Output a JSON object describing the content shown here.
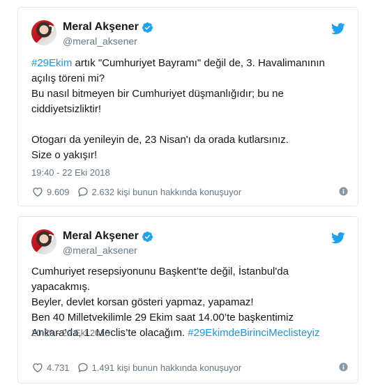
{
  "tweets": [
    {
      "author": "Meral Akşener",
      "handle": "@meral_aksener",
      "lines": [
        {
          "hashtag": "#29Ekim",
          "text": " artık \"Cumhuriyet Bayramı\" değil de, 3. Havalimanının"
        },
        {
          "text": "açılış töreni mi?"
        },
        {
          "text": "Bu nasıl bitmeyen bir Cumhuriyet düşmanlığıdır; bu ne"
        },
        {
          "text": "ciddiyetsizliktir!"
        },
        {
          "text": ""
        },
        {
          "text": "Otogarı da yenileyin de, 23 Nisan'ı da orada kutlarsınız."
        },
        {
          "text": "Size o yakışır!"
        }
      ],
      "timestamp": "19:40 - 22 Eki 2018",
      "likes": "9.609",
      "replies": "2.632 kişi bunun hakkında konuşuyor"
    },
    {
      "author": "Meral Akşener",
      "handle": "@meral_aksener",
      "lines": [
        {
          "text": "Cumhuriyet resepsiyonunu Başkent’te değil, İstanbul'da"
        },
        {
          "text": "yapacakmış."
        },
        {
          "text": "Beyler, devlet korsan gösteri yapmaz, yapamaz!"
        },
        {
          "text": "Ben 40 Milletvekilimle 29 Ekim saat 14.00’te başkentimiz"
        },
        {
          "text": "Ankara’da, 1. Meclis’te olacağım. ",
          "hashtag": "#29EkimdeBirinciMeclisteyiz"
        }
      ],
      "timestamp": "20:29 - 22 Eki 2018",
      "likes": "4.731",
      "replies": "1.491 kişi bunun hakkında konuşuyor"
    }
  ],
  "colors": {
    "link": "#1b95e0",
    "muted": "#657786",
    "border": "#e1e8ed",
    "verified": "#1da1f2"
  },
  "icons": [
    "verified-badge-icon",
    "twitter-bird-icon",
    "heart-icon",
    "reply-bubble-icon",
    "info-icon"
  ]
}
